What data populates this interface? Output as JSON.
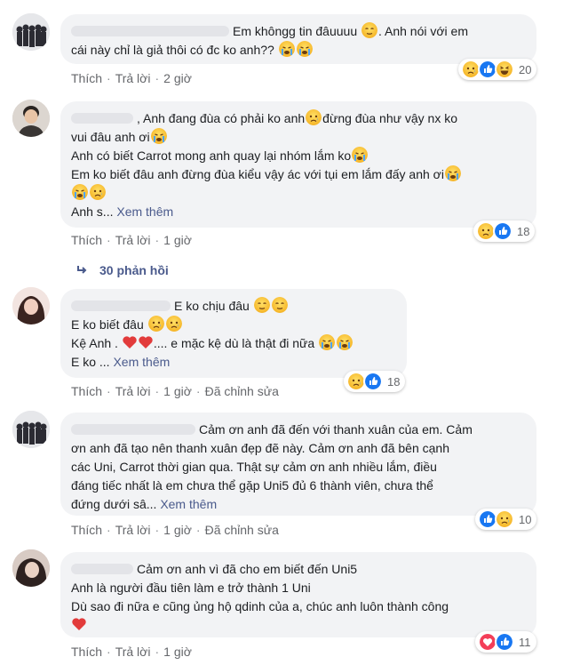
{
  "comments": [
    {
      "lines": [
        "Em khôngg tin đâuuuu",
        ". Anh nói với em",
        "cái này chỉ là giả thôi có đc ko anh??"
      ],
      "meta": {
        "like": "Thích",
        "reply": "Trả lời",
        "time": "2 giờ"
      },
      "reactions_count": "20"
    },
    {
      "lines": [
        ", Anh đang đùa có phải ko anh",
        "đừng đùa như vậy nx ko",
        "vui đâu anh ơi",
        "Anh có biết Carrot mong anh quay lại nhóm lắm ko",
        "Em ko biết đâu anh đừng đùa kiểu vậy ác với tụi em lắm đấy anh ơi",
        "Anh s... "
      ],
      "see_more": "Xem thêm",
      "meta": {
        "like": "Thích",
        "reply": "Trả lời",
        "time": "1 giờ"
      },
      "reactions_count": "18",
      "replies": "30 phản hồi"
    },
    {
      "lines": [
        "E ko chịu đâu",
        "E ko biết đâu",
        "Kệ Anh .",
        ".... e mặc kệ dù là thật đi nữa",
        "E ko ... "
      ],
      "see_more": "Xem thêm",
      "meta": {
        "like": "Thích",
        "reply": "Trả lời",
        "time": "1 giờ",
        "edited": "Đã chỉnh sửa"
      },
      "reactions_count": "18"
    },
    {
      "lines": [
        "Cảm ơn anh đã đến với thanh xuân của em. Cảm",
        "ơn anh đã tạo nên thanh xuân đẹp đẽ này. Cảm ơn anh đã bên cạnh",
        "các Uni, Carrot thời gian qua. Thật sự cảm ơn anh nhiều lắm, điều",
        "đáng tiếc nhất là em chưa thể gặp Uni5 đủ 6 thành viên, chưa thể",
        "đứng dưới sâ... "
      ],
      "see_more": "Xem thêm",
      "meta": {
        "like": "Thích",
        "reply": "Trả lời",
        "time": "1 giờ",
        "edited": "Đã chỉnh sửa"
      },
      "reactions_count": "10"
    },
    {
      "lines": [
        "Cảm ơn anh vì đã cho em biết đến Uni5",
        "Anh là người đầu tiên làm e trở thành 1 Uni",
        "Dù sao đi nữa e cũng ủng hộ qdinh của a, chúc anh luôn thành công"
      ],
      "meta": {
        "like": "Thích",
        "reply": "Trả lời",
        "time": "1 giờ"
      },
      "reactions_count": "11"
    }
  ],
  "colors": {
    "bubble": "#f2f3f5",
    "link": "#4a5a8c",
    "meta": "#65676b",
    "like_blue": "#1877f2",
    "heart_red": "#f33e58",
    "emoji_yellow": "#f7b928"
  },
  "icons": [
    "sad-emoji",
    "crying-emoji",
    "laughing-emoji",
    "relieved-emoji",
    "heart-emoji",
    "like-reaction",
    "sad-reaction",
    "haha-reaction",
    "love-reaction",
    "reply-arrow-icon"
  ]
}
